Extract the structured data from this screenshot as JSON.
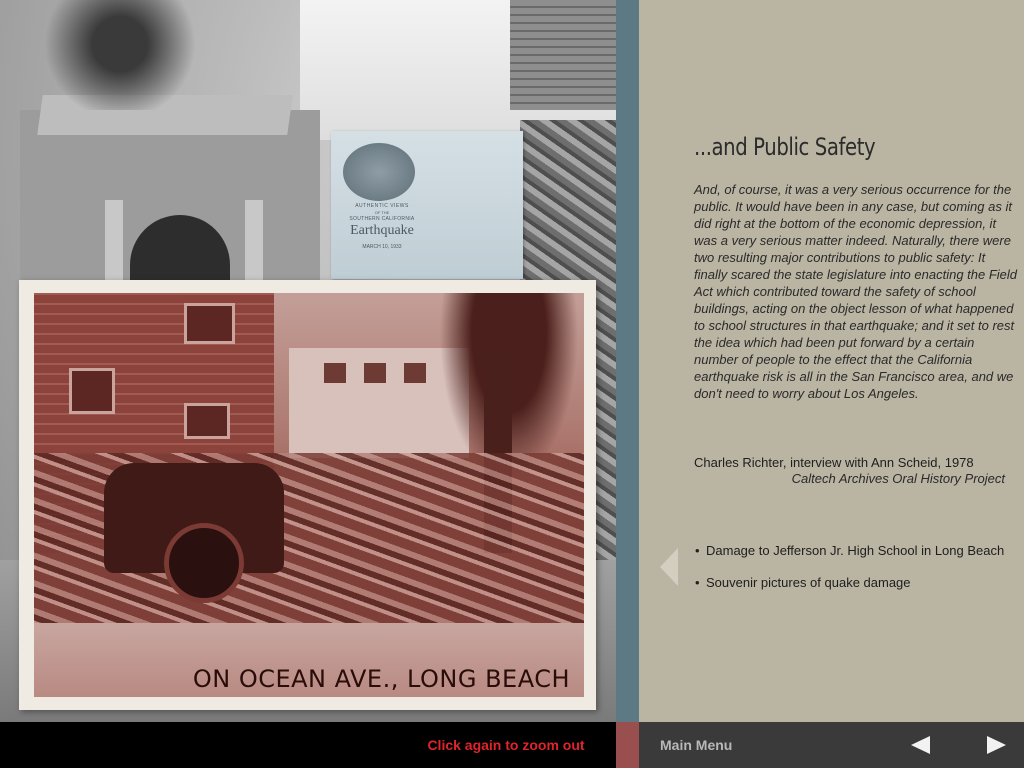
{
  "envelope": {
    "line1": "AUTHENTIC VIEWS",
    "line2": "OF THE",
    "line3": "SOUTHERN CALIFORNIA",
    "title": "Earthquake",
    "date": "MARCH 10, 1933"
  },
  "postcard": {
    "caption": "ON OCEAN AVE., LONG BEACH"
  },
  "section": {
    "heading": "...and Public Safety",
    "quote": "And, of course, it was a very serious occurrence for the public. It would have been in any case, but coming as it did right at the bottom of the economic depression, it was a very serious matter indeed. Naturally, there were two resulting major contributions to public safety: It finally scared the state legislature into enacting the Field Act which contributed toward the safety of school buildings, acting on the object lesson of what happened to school structures in that earthquake; and it set to rest the idea which had been put forward by a certain number of people to the effect that the California earthquake risk is all in the San Francisco area, and we don't need to worry about Los Angeles.",
    "attribution": "Charles Richter, interview with Ann Scheid, 1978",
    "attribution_source": "Caltech Archives Oral History Project",
    "links": [
      "Damage to Jefferson Jr. High School in Long Beach",
      "Souvenir pictures of quake damage"
    ]
  },
  "footer": {
    "zoom_hint": "Click again to zoom out",
    "main_menu": "Main Menu"
  },
  "icons": {
    "back": "triangle-left-icon",
    "prev": "triangle-left-icon",
    "next": "triangle-right-icon"
  },
  "colors": {
    "panel_bg": "#bab4a3",
    "stripe": "#5d7a84",
    "stripe_bottom": "#9a4f4f",
    "zoom_text": "#e0242b",
    "nav_bar": "#3a3a3a"
  }
}
